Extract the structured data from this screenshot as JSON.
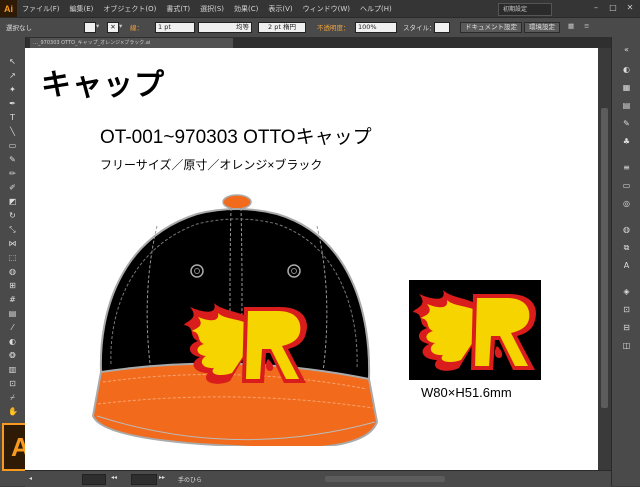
{
  "app": {
    "logo": "Ai",
    "badge": "Ai"
  },
  "menu": {
    "items": [
      "ファイル(F)",
      "編集(E)",
      "オブジェクト(O)",
      "書式(T)",
      "選択(S)",
      "効果(C)",
      "表示(V)",
      "ウィンドウ(W)",
      "ヘルプ(H)"
    ],
    "workspace": "初期設定"
  },
  "control": {
    "selection": "選択なし",
    "stroke_label": "線：",
    "stroke_weight": "1 pt",
    "stroke_style": "均等",
    "brush": "2 pt 楕円",
    "opacity_label": "不透明度：",
    "opacity_value": "100%",
    "style_label": "スタイル：",
    "doc_settings": "ドキュメント設定",
    "prefs": "環境設定"
  },
  "tab": {
    "filename": "…_970303 OTTO_キャップ_オレンジ×ブラック.ai"
  },
  "document": {
    "heading": "キャップ",
    "product_title": "OT-001~970303 OTTOキャップ",
    "spec": "フリーサイズ／原寸／オレンジ×ブラック",
    "size": "W80×H51.6mm",
    "logo_letter": "R"
  },
  "status": {
    "tool": "手のひら"
  },
  "colors": {
    "cap_black": "#000000",
    "brim_orange": "#f26a1b",
    "flame_yellow": "#f5d400",
    "flame_red": "#d91c1c",
    "ai_orange": "#f79a1f"
  }
}
